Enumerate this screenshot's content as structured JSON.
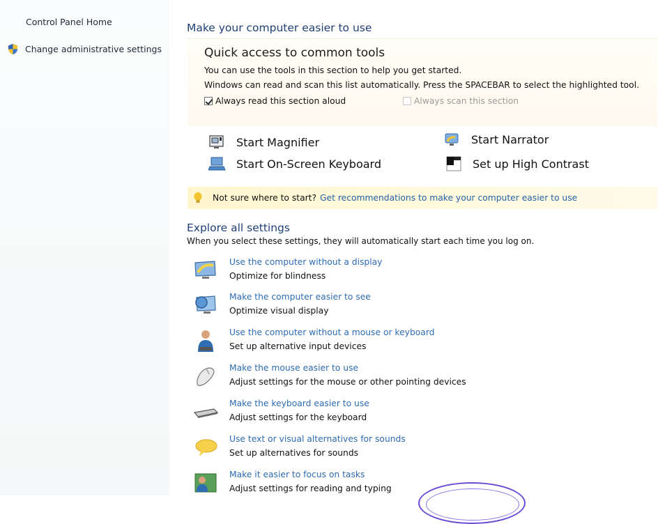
{
  "sidebar": {
    "home_label": "Control Panel Home",
    "admin_label": "Change administrative settings"
  },
  "main": {
    "title": "Make your computer easier to use",
    "quick": {
      "heading": "Quick access to common tools",
      "line1": "You can use the tools in this section to help you get started.",
      "line2": "Windows can read and scan this list automatically.  Press the SPACEBAR to select the highlighted tool.",
      "read_aloud": {
        "label": "Always read this section aloud",
        "checked": true
      },
      "scan": {
        "label": "Always scan this section",
        "checked": false
      }
    },
    "tools": [
      {
        "label": "Start Magnifier",
        "icon": "magnifier-icon"
      },
      {
        "label": "Start Narrator",
        "icon": "narrator-icon"
      },
      {
        "label": "Start On-Screen Keyboard",
        "icon": "on-screen-keyboard-icon"
      },
      {
        "label": "Set up High Contrast",
        "icon": "high-contrast-icon"
      }
    ],
    "tip": {
      "icon": "lightbulb-icon",
      "text": "Not sure where to start?",
      "link": "Get recommendations to make your computer easier to use"
    },
    "explore": {
      "title": "Explore all settings",
      "description": "When you select these settings, they will automatically start each time you log on.",
      "items": [
        {
          "link": "Use the computer without a display",
          "sub": "Optimize for blindness",
          "icon": "monitor-icon"
        },
        {
          "link": "Make the computer easier to see",
          "sub": "Optimize visual display",
          "icon": "magnified-display-icon"
        },
        {
          "link": "Use the computer without a mouse or keyboard",
          "sub": "Set up alternative input devices",
          "icon": "person-icon"
        },
        {
          "link": "Make the mouse easier to use",
          "sub": "Adjust settings for the mouse or other pointing devices",
          "icon": "mouse-icon"
        },
        {
          "link": "Make the keyboard easier to use",
          "sub": "Adjust settings for the keyboard",
          "icon": "keyboard-icon"
        },
        {
          "link": "Use text or visual alternatives for sounds",
          "sub": "Set up alternatives for sounds",
          "icon": "speech-bubble-icon"
        },
        {
          "link": "Make it easier to focus on tasks",
          "sub": "Adjust settings for reading and typing",
          "icon": "focus-tasks-icon"
        }
      ]
    }
  },
  "colors": {
    "link": "#2d6bb1",
    "heading": "#1f3f77",
    "tip_background": "#fff6cf"
  }
}
